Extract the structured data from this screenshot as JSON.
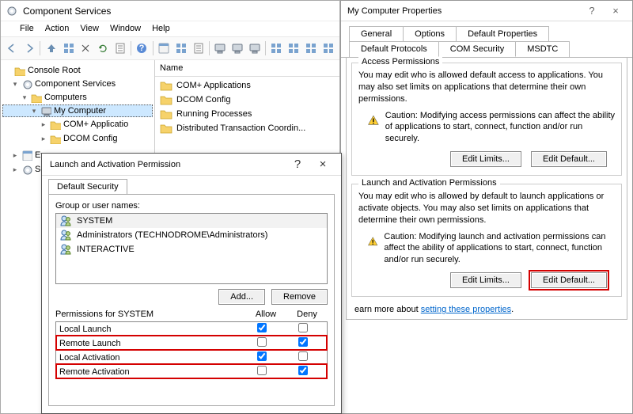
{
  "main": {
    "title": "Component Services",
    "menu": [
      "File",
      "Action",
      "View",
      "Window",
      "Help"
    ],
    "tree": {
      "root": "Console Root",
      "comp_services": "Component Services",
      "computers": "Computers",
      "my_computer": "My Computer",
      "com_app": "COM+ Applicatio",
      "dcom": "DCOM Config",
      "even": "Even",
      "servi": "Servi"
    },
    "list": {
      "header": "Name",
      "rows": [
        "COM+ Applications",
        "DCOM Config",
        "Running Processes",
        "Distributed Transaction Coordin..."
      ]
    }
  },
  "props": {
    "title": "My Computer Properties",
    "tabs_top": [
      "General",
      "Options",
      "Default Properties"
    ],
    "tabs_bottom": [
      "Default Protocols",
      "COM Security",
      "MSDTC"
    ],
    "access": {
      "legend": "Access Permissions",
      "desc": "You may edit who is allowed default access to applications. You may also set limits on applications that determine their own permissions.",
      "caution": "Caution: Modifying access permissions can affect the ability of applications to start, connect, function and/or run securely.",
      "btn_limits": "Edit Limits...",
      "btn_default": "Edit Default..."
    },
    "launch": {
      "legend": "Launch and Activation Permissions",
      "desc": "You may edit who is allowed by default to launch applications or activate objects. You may also set limits on applications that determine their own permissions.",
      "caution": "Caution: Modifying launch and activation permissions can affect the ability of applications to start, connect, function and/or run securely.",
      "btn_limits": "Edit Limits...",
      "btn_default": "Edit Default..."
    },
    "learn_prefix": "earn more about ",
    "learn_link": "setting these properties"
  },
  "perm": {
    "title": "Launch and Activation Permission",
    "tab": "Default Security",
    "group_label": "Group or user names:",
    "users": [
      "SYSTEM",
      "Administrators (TECHNODROME\\Administrators)",
      "INTERACTIVE"
    ],
    "btn_add": "Add...",
    "btn_remove": "Remove",
    "perm_for": "Permissions for SYSTEM",
    "col_allow": "Allow",
    "col_deny": "Deny",
    "rows": [
      {
        "name": "Local Launch",
        "allow": true,
        "deny": false,
        "hl": false
      },
      {
        "name": "Remote Launch",
        "allow": false,
        "deny": true,
        "hl": true
      },
      {
        "name": "Local Activation",
        "allow": true,
        "deny": false,
        "hl": false
      },
      {
        "name": "Remote Activation",
        "allow": false,
        "deny": true,
        "hl": true
      }
    ]
  }
}
